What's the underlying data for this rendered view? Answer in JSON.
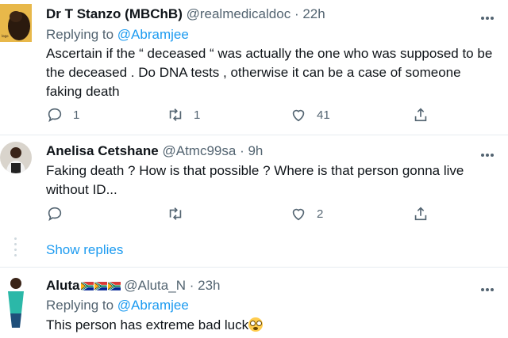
{
  "tweets": [
    {
      "name": "Dr T Stanzo (MBChB)",
      "handle": "@realmedicaldoc",
      "sep": "·",
      "time": "22h",
      "replying_label": "Replying to",
      "replying_handle": "@Abramjee",
      "text": "Ascertain if the “ deceased “ was actually the one who was supposed to be the deceased . Do DNA tests , otherwise it can be a case of someone faking death",
      "replies": "1",
      "retweets": "1",
      "likes": "41",
      "avatar_icon": "dog-avatar"
    },
    {
      "name": "Anelisa Cetshane",
      "handle": "@Atmc99sa",
      "sep": "·",
      "time": "9h",
      "text": "Faking death ? How is that possible ? Where is that person gonna live without ID...",
      "replies": "",
      "retweets": "",
      "likes": "2",
      "avatar_icon": "person-avatar"
    },
    {
      "name": "Aluta",
      "handle": "@Aluta_N",
      "sep": "·",
      "time": "23h",
      "replying_label": "Replying to",
      "replying_handle": "@Abramjee",
      "text": "This person has extreme bad luck",
      "flags": [
        "south-africa-flag-icon",
        "south-africa-flag-icon",
        "south-africa-flag-icon"
      ],
      "emoji": "flushed-face-icon",
      "avatar_icon": "person-avatar"
    }
  ],
  "show_replies": "Show replies",
  "colors": {
    "accent": "#1d9bf0",
    "muted": "#536471",
    "divider": "#e6ecf0"
  }
}
